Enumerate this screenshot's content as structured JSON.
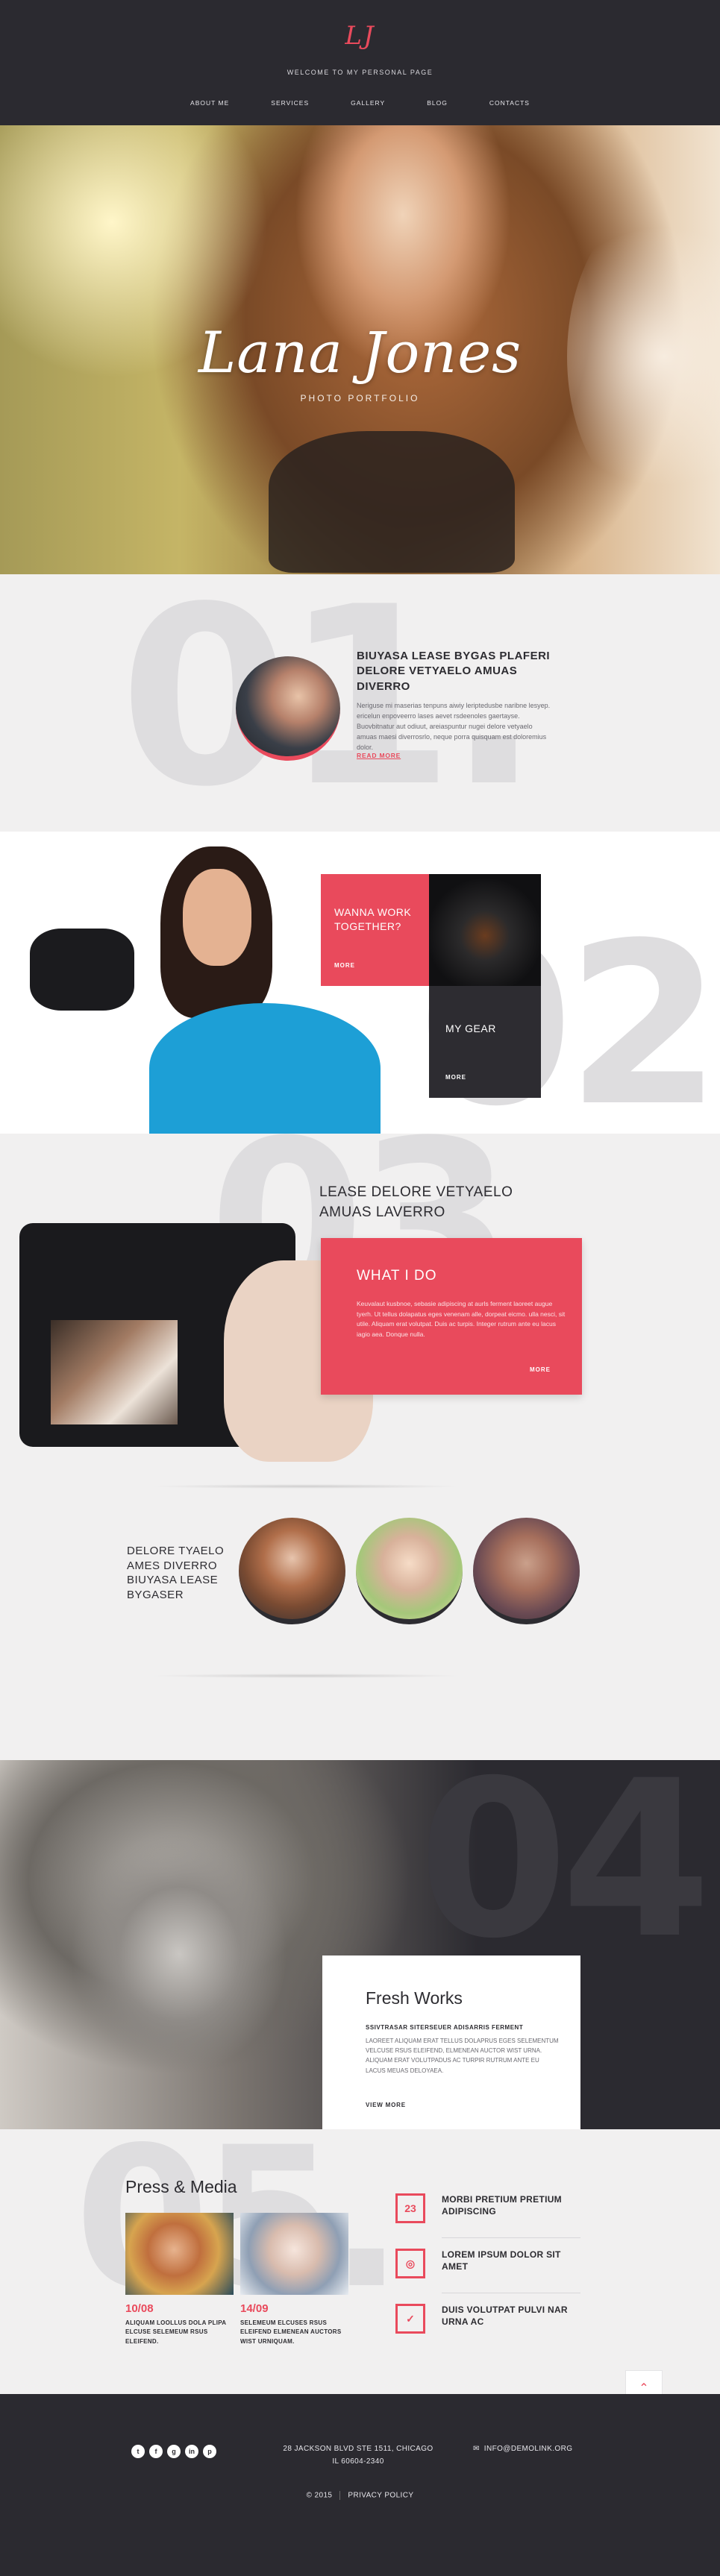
{
  "header": {
    "logo": "LJ",
    "tagline": "WELCOME TO MY PERSONAL PAGE",
    "nav": [
      "ABOUT ME",
      "SERVICES",
      "GALLERY",
      "BLOG",
      "CONTACTS"
    ]
  },
  "hero": {
    "title": "Lana Jones",
    "subtitle": "PHOTO PORTFOLIO"
  },
  "section1": {
    "number": "01.",
    "title": "BIUYASA LEASE BYGAS PLAFERI DELORE VETYAELO AMUAS DIVERRO",
    "text": "Neriguse mi maserias tenpuns aiwiy leriptedusbe naribne lesyep. ericelun enpoveerro lases aevet rsdeenoles gaertayse. Buovbitnatur aut odiuut, areiaspuntur nugei delore vetyaelo amuas maesi diverrosrlo, neque porra quisquam est doloremius dolor.",
    "read_more": "READ MORE"
  },
  "section2": {
    "number": "02.",
    "card1_title": "WANNA WORK TOGETHER?",
    "card1_more": "MORE",
    "card2_title": "MY GEAR",
    "card2_more": "MORE"
  },
  "section3": {
    "number": "03.",
    "title": "LEASE DELORE VETYAELO AMUAS LAVERRO",
    "card_title": "WHAT I DO",
    "card_text": "Keuvalaut kusbnoe, sebasie adipiscing at aurls ferment laoreet augue tyerh. Ut tellus dolapatus eges venenam alle, dorpeat eicmo. ulla nesci, sit utile. Aliquam erat volutpat. Duis ac turpis. Integer rutrum ante eu lacus iagio aea. Donque nulla.",
    "card_more": "MORE",
    "row_title": "DELORE TYAELO AMES DIVERRO BIUYASA LEASE BYGASER"
  },
  "section4": {
    "number": "04.",
    "title": "Fresh Works",
    "subtitle": "SSIVTRASAR SITERSEUER ADISARRIS FERMENT",
    "text": "LAOREET ALIQUAM ERAT TELLUS DOLAPRUS EGES SELEMENTUM VELCUSE RSUS ELEIFEND, ELMENEAN AUCTOR WIST URNA. ALIQUAM ERAT VOLUTPADUS AC TURPIR RUTRUM ANTE EU LACUS MEUAS DELOYAEA.",
    "more": "VIEW MORE"
  },
  "section5": {
    "number": "05.",
    "title": "Press & Media",
    "posts": [
      {
        "date": "10/08",
        "text": "ALIQUAM LOOLLUS DOLA PLIPA ELCUSE SELEMEUM RSUS ELEIFEND."
      },
      {
        "date": "14/09",
        "text": "SELEMEUM ELCUSES RSUS ELEIFEND ELMENEAN AUCTORS WIST URNIQUAM."
      }
    ],
    "features": [
      {
        "icon": "23",
        "icon_name": "calendar-icon",
        "text": "MORBI PRETIUM PRETIUM ADIPISCING"
      },
      {
        "icon": "◎",
        "icon_name": "camera-icon",
        "text": "LOREM IPSUM DOLOR SIT AMET"
      },
      {
        "icon": "✓",
        "icon_name": "check-icon",
        "text": "DUIS VOLUTPAT PULVI NAR URNA AC"
      }
    ],
    "to_top": "⌃"
  },
  "footer": {
    "social": [
      "t",
      "f",
      "g",
      "in",
      "p"
    ],
    "address_line1": "28 JACKSON BLVD STE 1511, CHICAGO",
    "address_line2": "IL 60604-2340",
    "email": "INFO@DEMOLINK.ORG",
    "copyright": "© 2015",
    "privacy": "PRIVACY POLICY"
  },
  "colors": {
    "accent": "#e94a5c",
    "dark": "#2b2a30",
    "light_bg": "#f1f0f0"
  }
}
